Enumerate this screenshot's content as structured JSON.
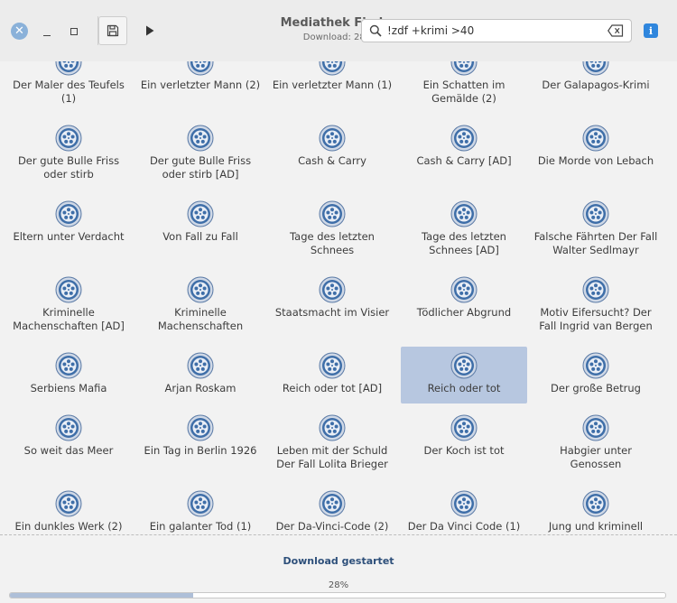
{
  "window": {
    "title": "Mediathek Finder",
    "subtitle": "Download: 28%",
    "close_glyph": "✕"
  },
  "search": {
    "value": "!zdf +krimi >40"
  },
  "icons": {
    "close": "close-icon",
    "minimize": "minimize-icon",
    "maximize": "maximize-icon",
    "save": "save-icon",
    "play": "play-icon",
    "search": "search-icon",
    "clear": "backspace-icon",
    "info": "info-icon",
    "film": "film-reel-icon"
  },
  "info_glyph": "i",
  "colors": {
    "accent": "#2f86dd",
    "selection": "#b7c7e0",
    "progress_fill": "#aebfd8",
    "status_text": "#2d4f7a"
  },
  "items": [
    {
      "label": "Der Maler des Teufels (1)"
    },
    {
      "label": "Ein verletzter Mann (2)"
    },
    {
      "label": "Ein verletzter Mann (1)"
    },
    {
      "label": "Ein Schatten im Gemälde (2)"
    },
    {
      "label": "Der Galapagos-Krimi"
    },
    {
      "label": "Der gute Bulle Friss oder stirb"
    },
    {
      "label": "Der gute Bulle Friss oder stirb [AD]"
    },
    {
      "label": "Cash & Carry"
    },
    {
      "label": "Cash & Carry [AD]"
    },
    {
      "label": "Die Morde von Lebach"
    },
    {
      "label": "Eltern unter Verdacht"
    },
    {
      "label": "Von Fall zu Fall"
    },
    {
      "label": "Tage des letzten Schnees"
    },
    {
      "label": "Tage des letzten Schnees [AD]"
    },
    {
      "label": "Falsche Fährten Der Fall Walter Sedlmayr"
    },
    {
      "label": "Kriminelle Machenschaften [AD]"
    },
    {
      "label": "Kriminelle Machenschaften"
    },
    {
      "label": "Staatsmacht im Visier"
    },
    {
      "label": "Tödlicher Abgrund"
    },
    {
      "label": "Motiv Eifersucht? Der Fall Ingrid van Bergen"
    },
    {
      "label": "Serbiens Mafia"
    },
    {
      "label": "Arjan Roskam"
    },
    {
      "label": "Reich oder tot [AD]"
    },
    {
      "label": "Reich oder tot",
      "selected": true
    },
    {
      "label": "Der große Betrug"
    },
    {
      "label": "So weit das Meer"
    },
    {
      "label": "Ein Tag in Berlin 1926"
    },
    {
      "label": "Leben mit der Schuld Der Fall Lolita Brieger"
    },
    {
      "label": "Der Koch ist tot"
    },
    {
      "label": "Habgier unter Genossen"
    },
    {
      "label": "Ein dunkles Werk (2)"
    },
    {
      "label": "Ein galanter Tod (1)"
    },
    {
      "label": "Der Da-Vinci-Code (2)"
    },
    {
      "label": "Der Da Vinci Code (1)"
    },
    {
      "label": "Jung und kriminell"
    }
  ],
  "status": {
    "message": "Download gestartet",
    "percent_label": "28%",
    "progress": 0.28
  }
}
